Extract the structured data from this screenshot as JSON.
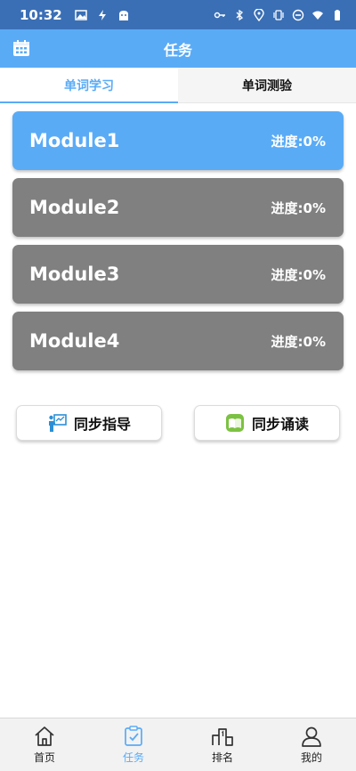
{
  "status_bar": {
    "time": "10:32"
  },
  "header": {
    "title": "任务"
  },
  "tabs": [
    {
      "label": "单词学习",
      "active": true
    },
    {
      "label": "单词测验",
      "active": false
    }
  ],
  "modules": [
    {
      "title": "Module1",
      "progress": "进度:0%",
      "active": true
    },
    {
      "title": "Module2",
      "progress": "进度:0%",
      "active": false
    },
    {
      "title": "Module3",
      "progress": "进度:0%",
      "active": false
    },
    {
      "title": "Module4",
      "progress": "进度:0%",
      "active": false
    }
  ],
  "actions": [
    {
      "label": "同步指导",
      "icon": "teacher-board-icon"
    },
    {
      "label": "同步诵读",
      "icon": "book-icon"
    }
  ],
  "bottom_nav": [
    {
      "label": "首页",
      "icon": "home-icon",
      "active": false
    },
    {
      "label": "任务",
      "icon": "task-icon",
      "active": true
    },
    {
      "label": "排名",
      "icon": "ranking-icon",
      "active": false
    },
    {
      "label": "我的",
      "icon": "profile-icon",
      "active": false
    }
  ],
  "colors": {
    "primary": "#5aabf6",
    "statusbar": "#3a6fb5",
    "module_inactive": "#808080"
  }
}
